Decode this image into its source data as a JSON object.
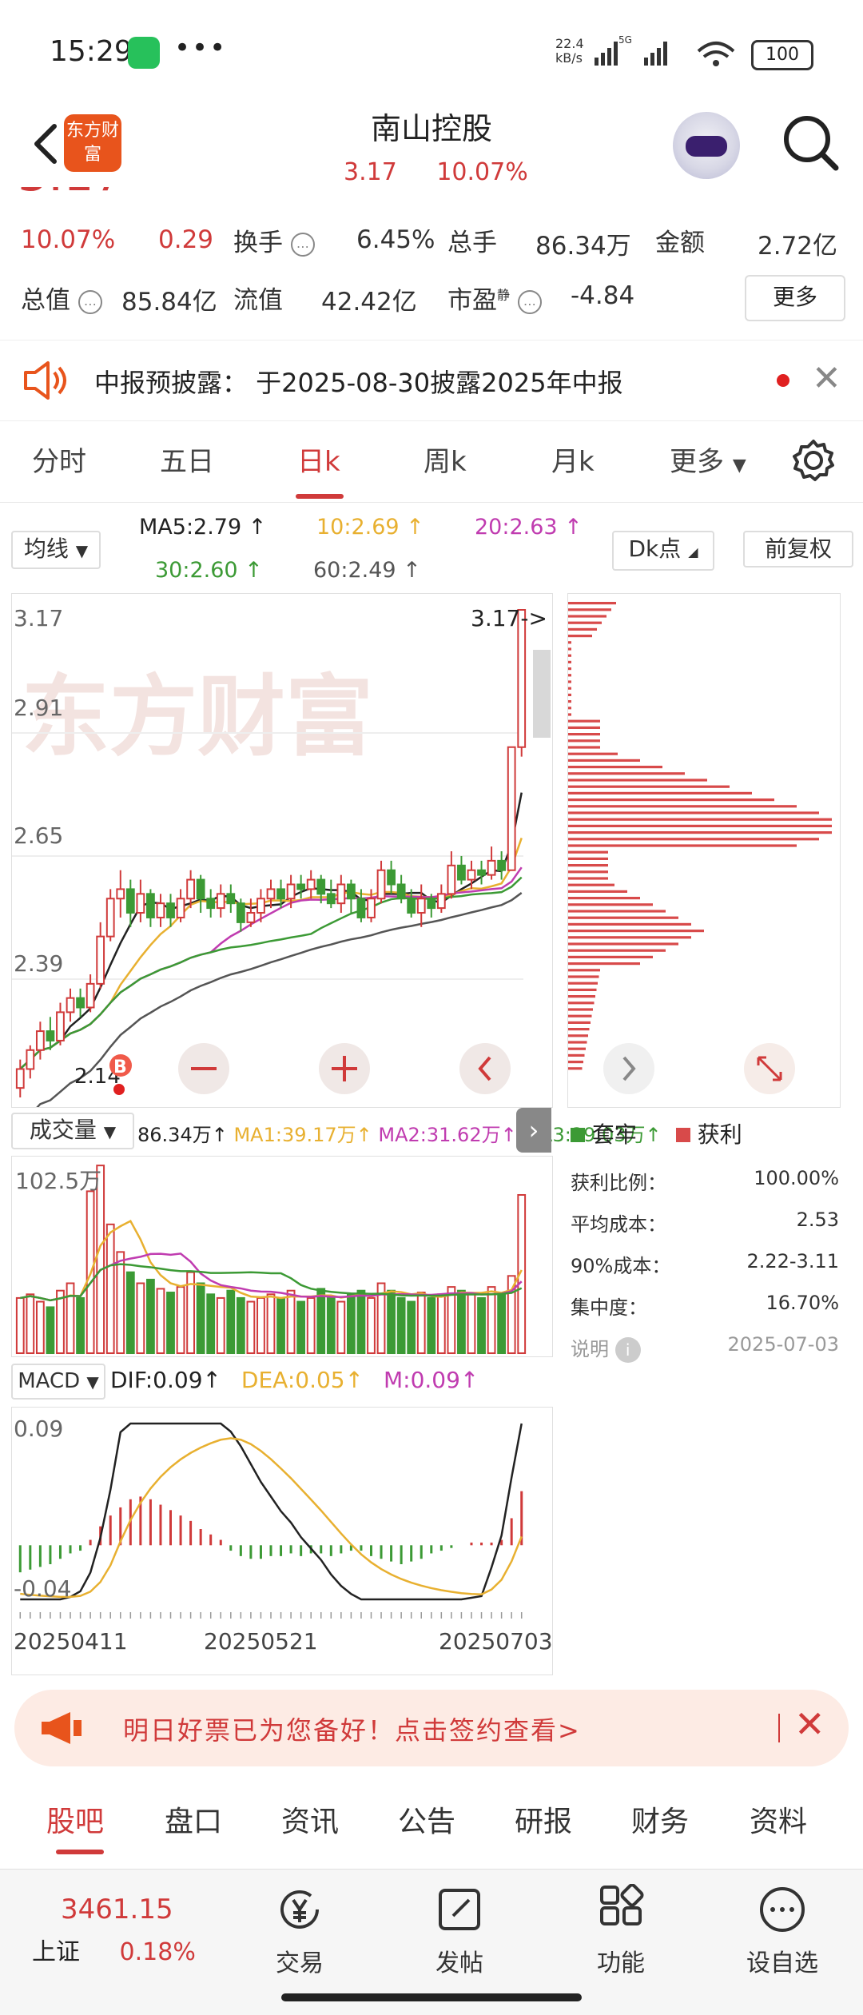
{
  "status_bar": {
    "time": "15:29",
    "net_speed": "22.4",
    "net_unit": "kB/s",
    "battery": "100"
  },
  "header": {
    "logo_text": "东方财富",
    "title": "南山控股",
    "price": "3.17",
    "change_pct": "10.07%"
  },
  "quote": {
    "row1": {
      "change_pct": "10.07%",
      "change_val": "0.29",
      "turnover_label": "换手",
      "turnover": "6.45%",
      "volume_label": "总手",
      "volume": "86.34万",
      "amount_label": "金额",
      "amount": "2.72亿"
    },
    "row2": {
      "total_mv_label": "总值",
      "total_mv": "85.84亿",
      "float_mv_label": "流值",
      "float_mv": "42.42亿",
      "pe_label": "市盈",
      "pe_sup": "静",
      "pe": "-4.84"
    },
    "more": "更多"
  },
  "notice": {
    "text": "中报预披露： 于2025-08-30披露2025年中报"
  },
  "k_tabs": [
    "分时",
    "五日",
    "日k",
    "周k",
    "月k",
    "更多"
  ],
  "ma_row": {
    "selector": "均线",
    "ma5": "MA5:2.79",
    "ma10": "10:2.69",
    "ma20": "20:2.63",
    "ma30": "30:2.60",
    "ma60": "60:2.49",
    "dk": "Dk点",
    "adjust": "前复权",
    "colors": {
      "ma5": "#222222",
      "ma10": "#e8b030",
      "ma20": "#c03cb0",
      "ma30": "#3c9a35",
      "ma60": "#555555"
    }
  },
  "price_chart": {
    "y_labels": [
      "3.17",
      "2.91",
      "2.65",
      "2.39",
      "2.14"
    ],
    "last_price_tag": "3.17->",
    "low_tag": "2.14",
    "buy_marker": "B"
  },
  "chip": {
    "legend_trapped": "套牢",
    "legend_profit": "获利",
    "rows": [
      {
        "label": "获利比例：",
        "value": "100.00%"
      },
      {
        "label": "平均成本：",
        "value": "2.53"
      },
      {
        "label": "90%成本：",
        "value": "2.22-3.11"
      },
      {
        "label": "集中度：",
        "value": "16.70%"
      }
    ],
    "note_label": "说明",
    "date": "2025-07-03"
  },
  "volume": {
    "selector": "成交量",
    "v": "86.34万",
    "ma1": "MA1:39.17万",
    "ma2": "MA2:31.62万",
    "ma3": "MA3:29.03万",
    "max_label": "102.5万"
  },
  "macd": {
    "selector": "MACD",
    "dif": "DIF:0.09",
    "dea": "DEA:0.05",
    "m": "M:0.09",
    "top_label": "0.09",
    "bottom_label": "-0.04"
  },
  "x_axis": [
    "20250411",
    "20250521",
    "20250703"
  ],
  "banner": {
    "text": "明日好票已为您备好！点击签约查看>"
  },
  "bottom_tabs": [
    "股吧",
    "盘口",
    "资讯",
    "公告",
    "研报",
    "财务",
    "资料"
  ],
  "nav": {
    "index_value": "3461.15",
    "index_name": "上证",
    "index_change": "0.18%",
    "items": [
      "交易",
      "发帖",
      "功能",
      "设自选"
    ]
  },
  "chart_data": {
    "type": "candlestick",
    "title": "",
    "x_range": [
      "20250411",
      "20250703"
    ],
    "ylim": [
      2.14,
      3.17
    ],
    "candles": [
      {
        "o": 2.16,
        "c": 2.2,
        "h": 2.22,
        "l": 2.14
      },
      {
        "o": 2.2,
        "c": 2.24,
        "h": 2.25,
        "l": 2.18
      },
      {
        "o": 2.24,
        "c": 2.28,
        "h": 2.3,
        "l": 2.22
      },
      {
        "o": 2.28,
        "c": 2.26,
        "h": 2.31,
        "l": 2.24
      },
      {
        "o": 2.26,
        "c": 2.32,
        "h": 2.34,
        "l": 2.25
      },
      {
        "o": 2.32,
        "c": 2.35,
        "h": 2.37,
        "l": 2.3
      },
      {
        "o": 2.35,
        "c": 2.33,
        "h": 2.37,
        "l": 2.31
      },
      {
        "o": 2.33,
        "c": 2.38,
        "h": 2.4,
        "l": 2.32
      },
      {
        "o": 2.38,
        "c": 2.48,
        "h": 2.51,
        "l": 2.37
      },
      {
        "o": 2.48,
        "c": 2.56,
        "h": 2.58,
        "l": 2.47
      },
      {
        "o": 2.56,
        "c": 2.58,
        "h": 2.62,
        "l": 2.52
      },
      {
        "o": 2.58,
        "c": 2.53,
        "h": 2.6,
        "l": 2.5
      },
      {
        "o": 2.53,
        "c": 2.57,
        "h": 2.6,
        "l": 2.51
      },
      {
        "o": 2.57,
        "c": 2.52,
        "h": 2.58,
        "l": 2.5
      },
      {
        "o": 2.52,
        "c": 2.55,
        "h": 2.57,
        "l": 2.5
      },
      {
        "o": 2.55,
        "c": 2.52,
        "h": 2.57,
        "l": 2.5
      },
      {
        "o": 2.52,
        "c": 2.56,
        "h": 2.58,
        "l": 2.51
      },
      {
        "o": 2.56,
        "c": 2.6,
        "h": 2.62,
        "l": 2.54
      },
      {
        "o": 2.6,
        "c": 2.56,
        "h": 2.61,
        "l": 2.53
      },
      {
        "o": 2.56,
        "c": 2.54,
        "h": 2.58,
        "l": 2.52
      },
      {
        "o": 2.54,
        "c": 2.57,
        "h": 2.59,
        "l": 2.52
      },
      {
        "o": 2.57,
        "c": 2.55,
        "h": 2.59,
        "l": 2.53
      },
      {
        "o": 2.55,
        "c": 2.51,
        "h": 2.56,
        "l": 2.49
      },
      {
        "o": 2.51,
        "c": 2.53,
        "h": 2.56,
        "l": 2.5
      },
      {
        "o": 2.53,
        "c": 2.56,
        "h": 2.58,
        "l": 2.51
      },
      {
        "o": 2.56,
        "c": 2.58,
        "h": 2.6,
        "l": 2.54
      },
      {
        "o": 2.58,
        "c": 2.56,
        "h": 2.6,
        "l": 2.54
      },
      {
        "o": 2.56,
        "c": 2.59,
        "h": 2.61,
        "l": 2.54
      },
      {
        "o": 2.59,
        "c": 2.58,
        "h": 2.61,
        "l": 2.56
      },
      {
        "o": 2.58,
        "c": 2.6,
        "h": 2.62,
        "l": 2.56
      },
      {
        "o": 2.6,
        "c": 2.57,
        "h": 2.61,
        "l": 2.55
      },
      {
        "o": 2.57,
        "c": 2.55,
        "h": 2.6,
        "l": 2.54
      },
      {
        "o": 2.55,
        "c": 2.59,
        "h": 2.61,
        "l": 2.53
      },
      {
        "o": 2.59,
        "c": 2.56,
        "h": 2.6,
        "l": 2.53
      },
      {
        "o": 2.56,
        "c": 2.52,
        "h": 2.58,
        "l": 2.51
      },
      {
        "o": 2.52,
        "c": 2.56,
        "h": 2.58,
        "l": 2.51
      },
      {
        "o": 2.56,
        "c": 2.62,
        "h": 2.64,
        "l": 2.55
      },
      {
        "o": 2.62,
        "c": 2.59,
        "h": 2.64,
        "l": 2.57
      },
      {
        "o": 2.59,
        "c": 2.56,
        "h": 2.61,
        "l": 2.55
      },
      {
        "o": 2.56,
        "c": 2.53,
        "h": 2.58,
        "l": 2.52
      },
      {
        "o": 2.53,
        "c": 2.56,
        "h": 2.59,
        "l": 2.5
      },
      {
        "o": 2.56,
        "c": 2.54,
        "h": 2.57,
        "l": 2.52
      },
      {
        "o": 2.54,
        "c": 2.57,
        "h": 2.59,
        "l": 2.53
      },
      {
        "o": 2.57,
        "c": 2.63,
        "h": 2.66,
        "l": 2.56
      },
      {
        "o": 2.63,
        "c": 2.6,
        "h": 2.65,
        "l": 2.59
      },
      {
        "o": 2.6,
        "c": 2.62,
        "h": 2.64,
        "l": 2.58
      },
      {
        "o": 2.62,
        "c": 2.61,
        "h": 2.64,
        "l": 2.59
      },
      {
        "o": 2.61,
        "c": 2.64,
        "h": 2.67,
        "l": 2.6
      },
      {
        "o": 2.64,
        "c": 2.62,
        "h": 2.66,
        "l": 2.6
      },
      {
        "o": 2.62,
        "c": 2.88,
        "h": 2.88,
        "l": 2.62
      },
      {
        "o": 2.88,
        "c": 3.17,
        "h": 3.17,
        "l": 2.86
      }
    ],
    "ma_lines": [
      "MA5",
      "MA10",
      "MA20",
      "MA30",
      "MA60"
    ],
    "volume_max": 102.5,
    "volume_unit": "万",
    "volumes": [
      30,
      32,
      28,
      25,
      34,
      38,
      30,
      88,
      102,
      70,
      55,
      44,
      38,
      40,
      35,
      33,
      36,
      44,
      38,
      32,
      30,
      34,
      30,
      28,
      30,
      32,
      30,
      34,
      28,
      30,
      35,
      30,
      28,
      32,
      34,
      30,
      38,
      34,
      30,
      28,
      33,
      30,
      32,
      36,
      34,
      32,
      30,
      36,
      32,
      42,
      86
    ],
    "volume_ma": {
      "MA1": 39.17,
      "MA2": 31.62,
      "MA3": 29.03
    },
    "macd_range": [
      -0.04,
      0.09
    ],
    "macd_hist": [
      -0.02,
      -0.018,
      -0.016,
      -0.014,
      -0.01,
      -0.006,
      -0.004,
      0.004,
      0.014,
      0.022,
      0.028,
      0.034,
      0.036,
      0.034,
      0.03,
      0.026,
      0.022,
      0.018,
      0.012,
      0.008,
      0.004,
      -0.004,
      -0.008,
      -0.01,
      -0.01,
      -0.008,
      -0.008,
      -0.006,
      -0.008,
      -0.006,
      -0.006,
      -0.008,
      -0.006,
      -0.004,
      -0.004,
      -0.008,
      -0.01,
      -0.012,
      -0.014,
      -0.012,
      -0.01,
      -0.006,
      -0.004,
      -0.002,
      0.0,
      0.002,
      0.002,
      0.002,
      0.004,
      0.02,
      0.04
    ]
  }
}
